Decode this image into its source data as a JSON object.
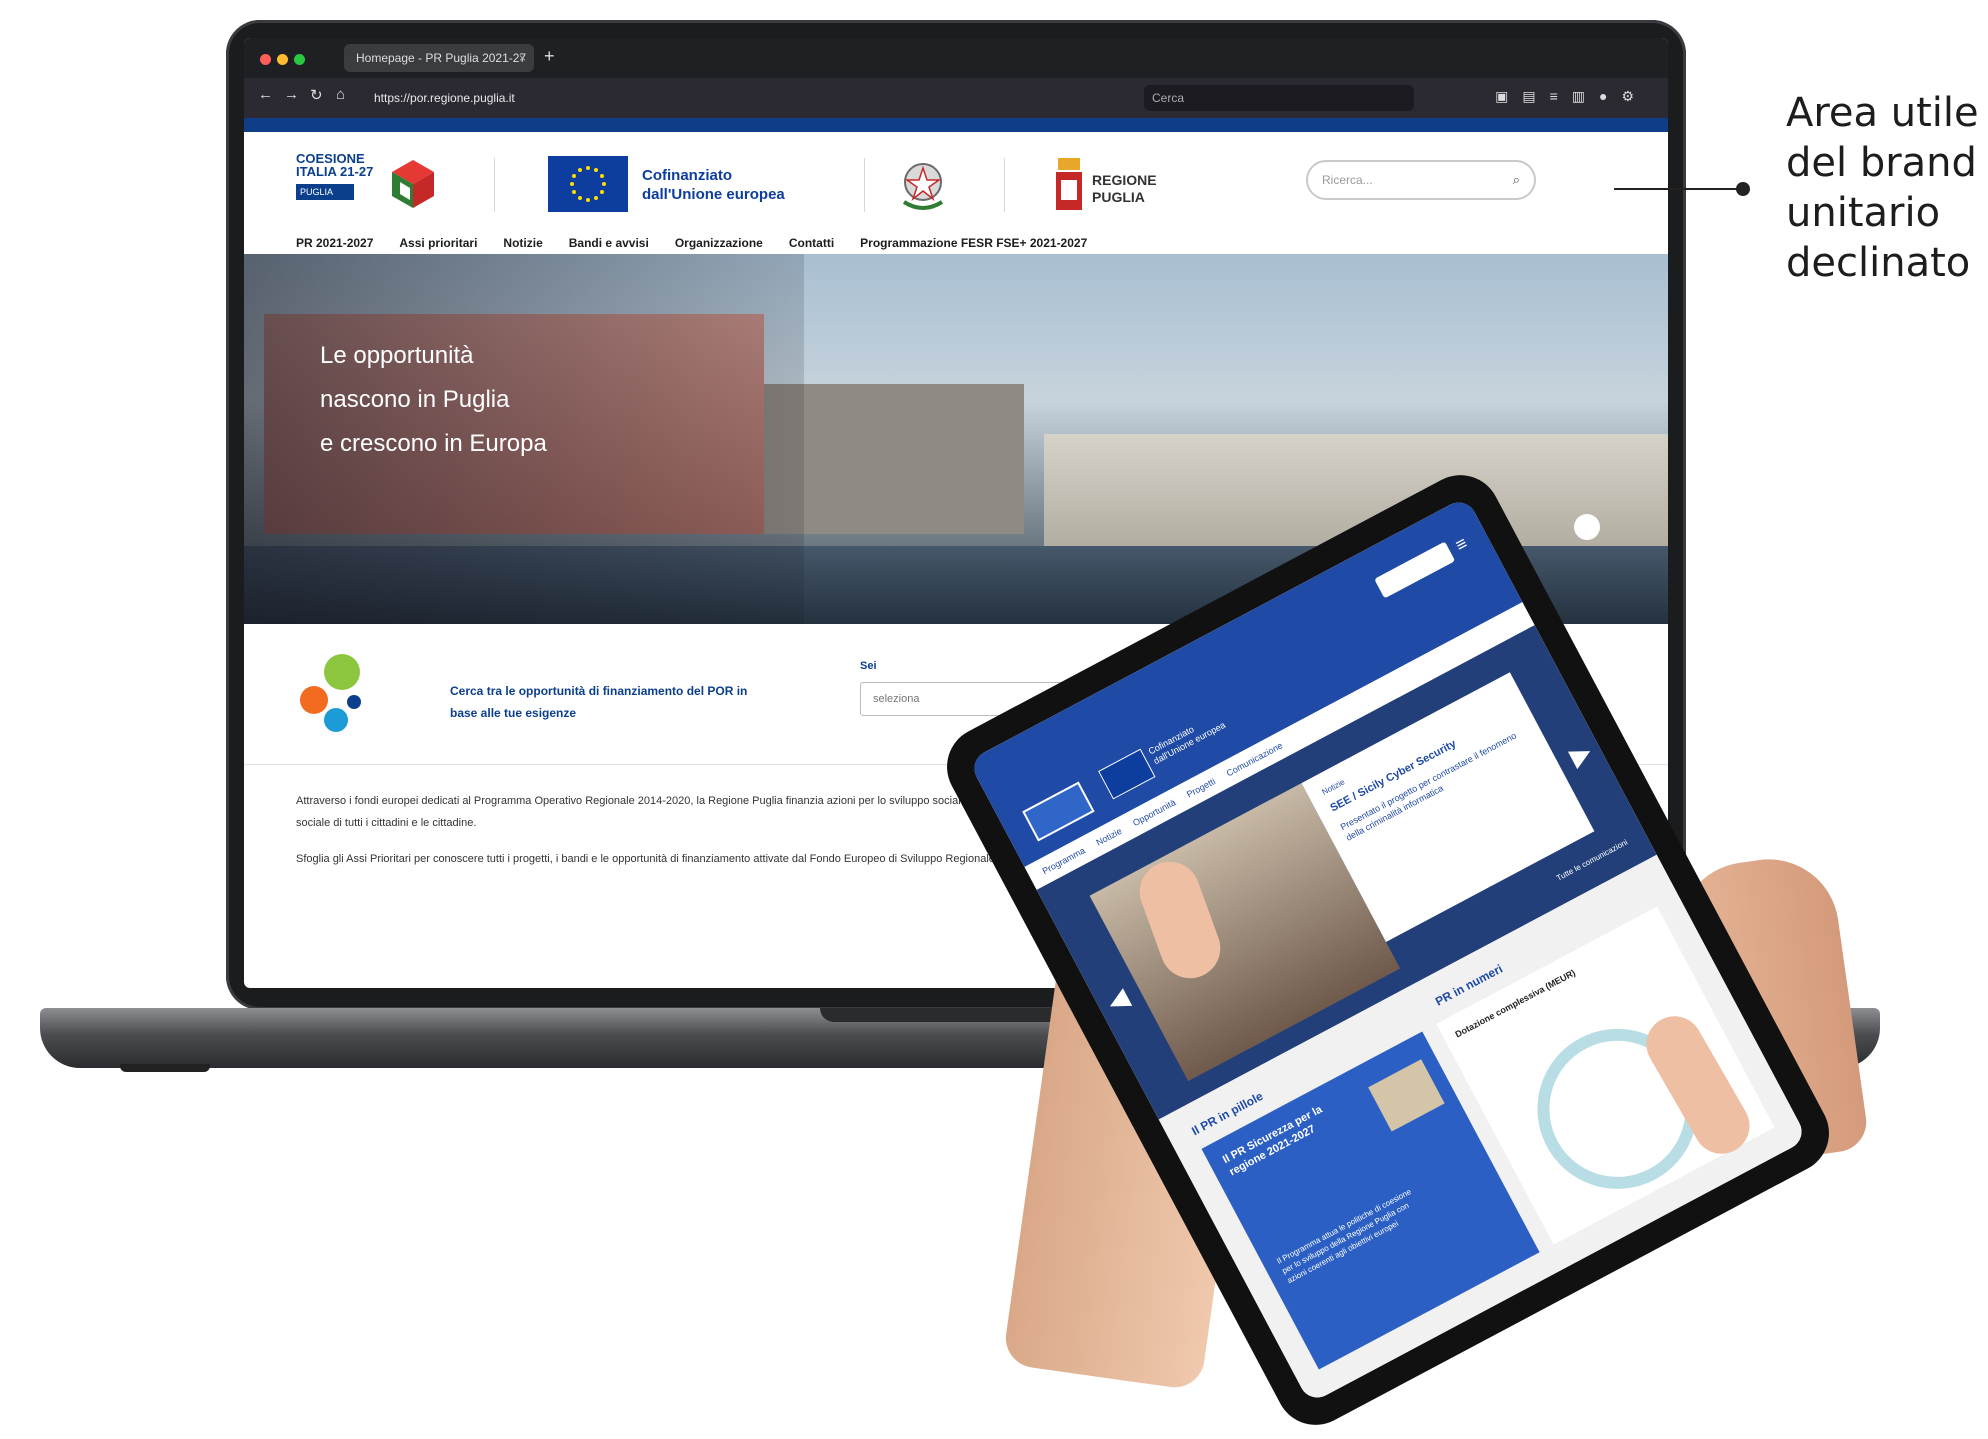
{
  "annotation": {
    "lines": [
      "Area utile",
      "del brand",
      "unitario",
      "declinato"
    ]
  },
  "browser": {
    "tab_title": "Homepage - PR Puglia 2021-27",
    "url": "https://por.regione.puglia.it",
    "search_placeholder": "Cerca"
  },
  "site": {
    "logo_coesione": "COESIONE ITALIA 21-27",
    "logo_coesione_sub": "PUGLIA",
    "eu_text": "Cofinanziato dall'Unione europea",
    "region_text": "REGIONE PUGLIA",
    "search_placeholder": "Ricerca...",
    "nav": [
      "PR 2021-2027",
      "Assi prioritari",
      "Notizie",
      "Bandi e avvisi",
      "Organizzazione",
      "Contatti",
      "Programmazione FESR FSE+ 2021-2027"
    ],
    "hero_title_lines": [
      "Le opportunità",
      "nascono in Puglia",
      "e crescono in Europa"
    ],
    "finder_text": "Cerca tra le opportunità di finanziamento del POR in base alle tue esigenze",
    "finder_label": "Sei",
    "finder_select": "seleziona",
    "body_p1": "Attraverso i fondi europei dedicati al Programma Operativo Regionale 2014-2020, la Regione Puglia finanzia azioni per lo sviluppo sociale, lavorativo, imprenditoriale, culturale, tecnologico, scientifico, ambientale e infrastrutturale, ponendo particolare attenzione all'inclusione sociale di tutti i cittadini e le cittadine.",
    "body_p2": "Sfoglia gli Assi Prioritari per conoscere tutti i progetti, i bandi e le opportunità di finanziamento attivate dal Fondo Europeo di Sviluppo Regionale e dal Fondo Sociale Europeo."
  },
  "tablet": {
    "eu_text": "Cofinanziato dall'Unione europea",
    "nav": [
      "Programma",
      "Notizie",
      "Opportunità",
      "Progetti",
      "Comunicazione"
    ],
    "card_tag": "Notizie",
    "card_title": "SEE / Sicily Cyber Security",
    "card_desc": "Presentato il progetto per contrastare il fenomeno della criminalità informatica",
    "all_news": "Tutte le comunicazioni",
    "glance_title": "Il PR in pillole",
    "glance_card_title": "Il PR Sicurezza per la regione 2021-2027",
    "glance_desc": "Il Programma attua le politiche di coesione per lo sviluppo della Regione Puglia con azioni coerenti agli obiettivi europei",
    "numbers_title": "PR in numeri",
    "numbers_sub": "Dotazione complessiva (MEUR)"
  }
}
